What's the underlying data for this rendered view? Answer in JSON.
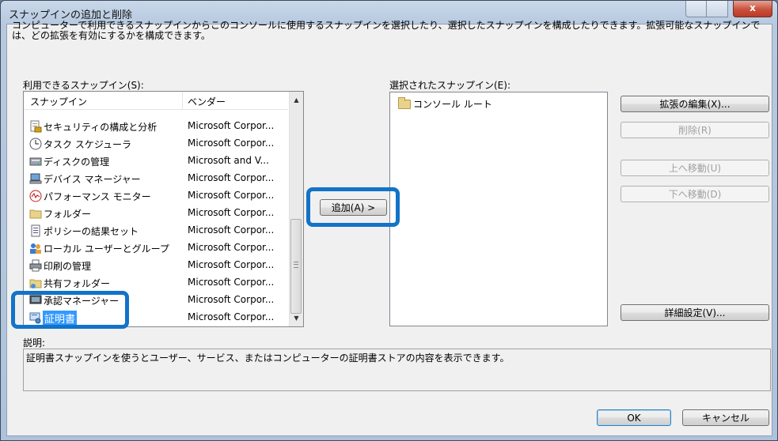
{
  "window": {
    "title": "スナップインの追加と削除",
    "close_symbol": "x"
  },
  "intro": "コンピューターで利用できるスナップインからこのコンソールに使用するスナップインを選択したり、選択したスナップインを構成したりできます。拡張可能なスナップインでは、どの拡張を有効にするかを構成できます。",
  "available": {
    "label": "利用できるスナップイン(S):",
    "columns": [
      "スナップイン",
      "ベンダー"
    ],
    "items": [
      {
        "name": "セキュリティの構成と分析",
        "vendor": "Microsoft Corpor...",
        "icon": "security-config-icon"
      },
      {
        "name": "タスク スケジューラ",
        "vendor": "Microsoft Corpor...",
        "icon": "clock-icon"
      },
      {
        "name": "ディスクの管理",
        "vendor": "Microsoft and V...",
        "icon": "disk-icon"
      },
      {
        "name": "デバイス マネージャー",
        "vendor": "Microsoft Corpor...",
        "icon": "device-manager-icon"
      },
      {
        "name": "パフォーマンス モニター",
        "vendor": "Microsoft Corpor...",
        "icon": "performance-monitor-icon"
      },
      {
        "name": "フォルダー",
        "vendor": "Microsoft Corpor...",
        "icon": "folder-icon"
      },
      {
        "name": "ポリシーの結果セット",
        "vendor": "Microsoft Corpor...",
        "icon": "policy-icon"
      },
      {
        "name": "ローカル ユーザーとグループ",
        "vendor": "Microsoft Corpor...",
        "icon": "users-icon"
      },
      {
        "name": "印刷の管理",
        "vendor": "Microsoft Corpor...",
        "icon": "printer-icon"
      },
      {
        "name": "共有フォルダー",
        "vendor": "Microsoft Corpor...",
        "icon": "shared-folder-icon"
      },
      {
        "name": "承認マネージャー",
        "vendor": "Microsoft Corpor...",
        "icon": "authorization-icon"
      },
      {
        "name": "証明書",
        "vendor": "Microsoft Corpor...",
        "icon": "certificate-icon",
        "selected": true
      }
    ]
  },
  "add_button": "追加(A) >",
  "selected": {
    "label": "選択されたスナップイン(E):",
    "items": [
      {
        "name": "コンソール ルート",
        "icon": "folder-icon"
      }
    ]
  },
  "buttons": {
    "edit_extensions": "拡張の編集(X)...",
    "remove": "削除(R)",
    "move_up": "上へ移動(U)",
    "move_down": "下へ移動(D)",
    "advanced": "詳細設定(V)...",
    "ok": "OK",
    "cancel": "キャンセル"
  },
  "description": {
    "label": "説明:",
    "text": "証明書スナップインを使うとユーザー、サービス、またはコンピューターの証明書ストアの内容を表示できます。"
  },
  "colors": {
    "highlight": "#1273c8",
    "selection": "#3399ff"
  }
}
